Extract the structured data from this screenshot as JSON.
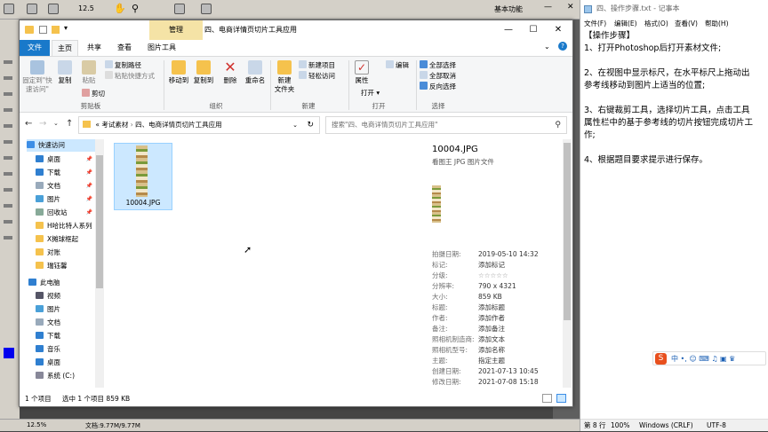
{
  "photoshop": {
    "zoom_top": "12.5",
    "workspace": "基本功能",
    "zoom_status": "12.5%",
    "doc_status": "文档:9.77M/9.77M"
  },
  "explorer": {
    "manage_tab": "管理",
    "title": "四、电商详情页切片工具应用",
    "tabs": [
      "文件",
      "主页",
      "共享",
      "查看",
      "图片工具"
    ],
    "ribbon": {
      "pin_quick": "固定到\"快\n速访问\"",
      "copy": "复制",
      "paste": "粘贴",
      "copy_path": "复制路径",
      "paste_shortcut": "粘贴快捷方式",
      "cut": "剪切",
      "group_clipboard": "剪贴板",
      "move_to": "移动到",
      "copy_to": "复制到",
      "delete": "删除",
      "rename": "重命名",
      "group_organize": "组织",
      "new_folder": "新建\n文件夹",
      "new_item": "新建项目",
      "easy_access": "轻松访问",
      "group_new": "新建",
      "properties": "属性",
      "open": "打开",
      "edit": "编辑",
      "group_open": "打开",
      "select_all": "全部选择",
      "select_none": "全部取消",
      "invert_select": "反向选择",
      "group_select": "选择"
    },
    "address": {
      "prefix": "«",
      "crumb1": "考试素材",
      "crumb2": "四、电商详情页切片工具应用",
      "search_placeholder": "搜索\"四、电商详情页切片工具应用\""
    },
    "nav": [
      {
        "label": "快速访问",
        "level": 0
      },
      {
        "label": "桌面",
        "level": 1,
        "pinned": true
      },
      {
        "label": "下载",
        "level": 1,
        "pinned": true
      },
      {
        "label": "文档",
        "level": 1,
        "pinned": true
      },
      {
        "label": "图片",
        "level": 1,
        "pinned": true
      },
      {
        "label": "回收站",
        "level": 1,
        "pinned": true
      },
      {
        "label": "H哈比特人系列",
        "level": 1
      },
      {
        "label": "X摊球框起",
        "level": 1
      },
      {
        "label": "对账",
        "level": 1
      },
      {
        "label": "瑞钰馨",
        "level": 1
      },
      {
        "label": "此电脑",
        "level": 0
      },
      {
        "label": "视频",
        "level": 1
      },
      {
        "label": "图片",
        "level": 1
      },
      {
        "label": "文档",
        "level": 1
      },
      {
        "label": "下载",
        "level": 1
      },
      {
        "label": "音乐",
        "level": 1
      },
      {
        "label": "桌面",
        "level": 1
      },
      {
        "label": "系统 (C:)",
        "level": 1
      }
    ],
    "file": {
      "name": "10004.JPG"
    },
    "details": {
      "filename": "10004.JPG",
      "filetype": "看图王 JPG 图片文件",
      "rows": [
        {
          "key": "拍摄日期:",
          "value": "2019-05-10 14:32"
        },
        {
          "key": "标记:",
          "value": "添加标记"
        },
        {
          "key": "分级:",
          "value": "☆☆☆☆☆"
        },
        {
          "key": "分辨率:",
          "value": "790 x 4321"
        },
        {
          "key": "大小:",
          "value": "859 KB"
        },
        {
          "key": "标题:",
          "value": "添加标题"
        },
        {
          "key": "作者:",
          "value": "添加作者"
        },
        {
          "key": "备注:",
          "value": "添加备注"
        },
        {
          "key": "照相机制造商:",
          "value": "添加文本"
        },
        {
          "key": "照相机型号:",
          "value": "添加名称"
        },
        {
          "key": "主题:",
          "value": "指定主题"
        },
        {
          "key": "创建日期:",
          "value": "2021-07-13 10:45"
        },
        {
          "key": "修改日期:",
          "value": "2021-07-08 15:18"
        }
      ]
    },
    "status": {
      "count": "1 个项目",
      "selected": "选中 1 个项目  859 KB"
    }
  },
  "notepad": {
    "title": "四、操作步骤.txt - 记事本",
    "menu": [
      "文件(F)",
      "编辑(E)",
      "格式(O)",
      "查看(V)",
      "帮助(H)"
    ],
    "text": "【操作步骤】\n1、打开Photoshop后打开素材文件;\n\n2、在视图中显示标尺，在水平标尺上拖动出参考线移动到图片上适当的位置;\n\n3、右键裁剪工具，选择切片工具，点击工具属性栏中的基于参考线的切片按钮完成切片工作;\n\n4、根据题目要求提示进行保存。",
    "status_line": "第 8 行",
    "status_zoom": "100%",
    "status_eol": "Windows (CRLF)",
    "status_enc": "UTF-8",
    "ime": "中 •, ☺ ⌨ ♫ ▣ ♛"
  }
}
